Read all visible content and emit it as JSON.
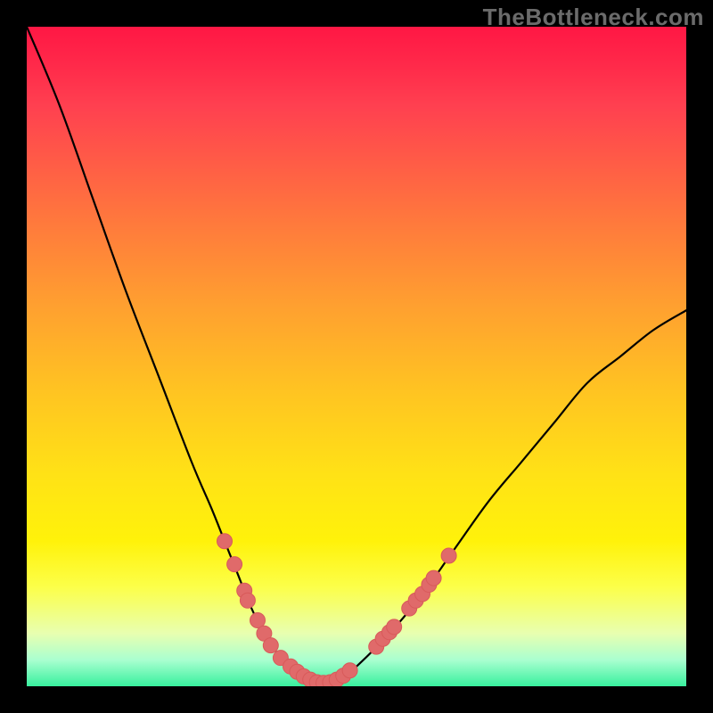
{
  "watermark": "TheBottleneck.com",
  "chart_data": {
    "type": "line",
    "title": "",
    "xlabel": "",
    "ylabel": "",
    "xlim": [
      0,
      100
    ],
    "ylim": [
      0,
      100
    ],
    "grid": false,
    "series": [
      {
        "name": "bottleneck-curve",
        "x": [
          0,
          5,
          10,
          15,
          20,
          25,
          28,
          30,
          32,
          34,
          36,
          38,
          40,
          42,
          44,
          46,
          48,
          50,
          55,
          60,
          65,
          70,
          75,
          80,
          85,
          90,
          95,
          100
        ],
        "values": [
          100,
          88,
          74,
          60,
          47,
          34,
          27,
          22,
          17,
          12,
          8,
          5,
          3,
          1.5,
          0.5,
          0.5,
          1.5,
          3,
          8,
          14,
          21,
          28,
          34,
          40,
          46,
          50,
          54,
          57
        ]
      }
    ],
    "markers": [
      {
        "x": 30,
        "y": 22
      },
      {
        "x": 31.5,
        "y": 18.5
      },
      {
        "x": 33,
        "y": 14.5
      },
      {
        "x": 33.5,
        "y": 13
      },
      {
        "x": 35,
        "y": 10
      },
      {
        "x": 36,
        "y": 8
      },
      {
        "x": 37,
        "y": 6.2
      },
      {
        "x": 38.5,
        "y": 4.3
      },
      {
        "x": 40,
        "y": 3
      },
      {
        "x": 41,
        "y": 2.2
      },
      {
        "x": 42,
        "y": 1.5
      },
      {
        "x": 43,
        "y": 1
      },
      {
        "x": 44,
        "y": 0.6
      },
      {
        "x": 45,
        "y": 0.5
      },
      {
        "x": 46,
        "y": 0.6
      },
      {
        "x": 47,
        "y": 1
      },
      {
        "x": 48,
        "y": 1.6
      },
      {
        "x": 49,
        "y": 2.4
      },
      {
        "x": 53,
        "y": 6
      },
      {
        "x": 54,
        "y": 7.2
      },
      {
        "x": 55,
        "y": 8.2
      },
      {
        "x": 55.7,
        "y": 9
      },
      {
        "x": 58,
        "y": 11.8
      },
      {
        "x": 59,
        "y": 13
      },
      {
        "x": 60,
        "y": 14
      },
      {
        "x": 61,
        "y": 15.4
      },
      {
        "x": 61.7,
        "y": 16.4
      },
      {
        "x": 64,
        "y": 19.8
      }
    ],
    "colors": {
      "curve": "#000000",
      "marker_fill": "#e06a6a",
      "marker_stroke": "#d85a5a",
      "gradient_top": "#ff1744",
      "gradient_bottom": "#38f09e"
    }
  }
}
